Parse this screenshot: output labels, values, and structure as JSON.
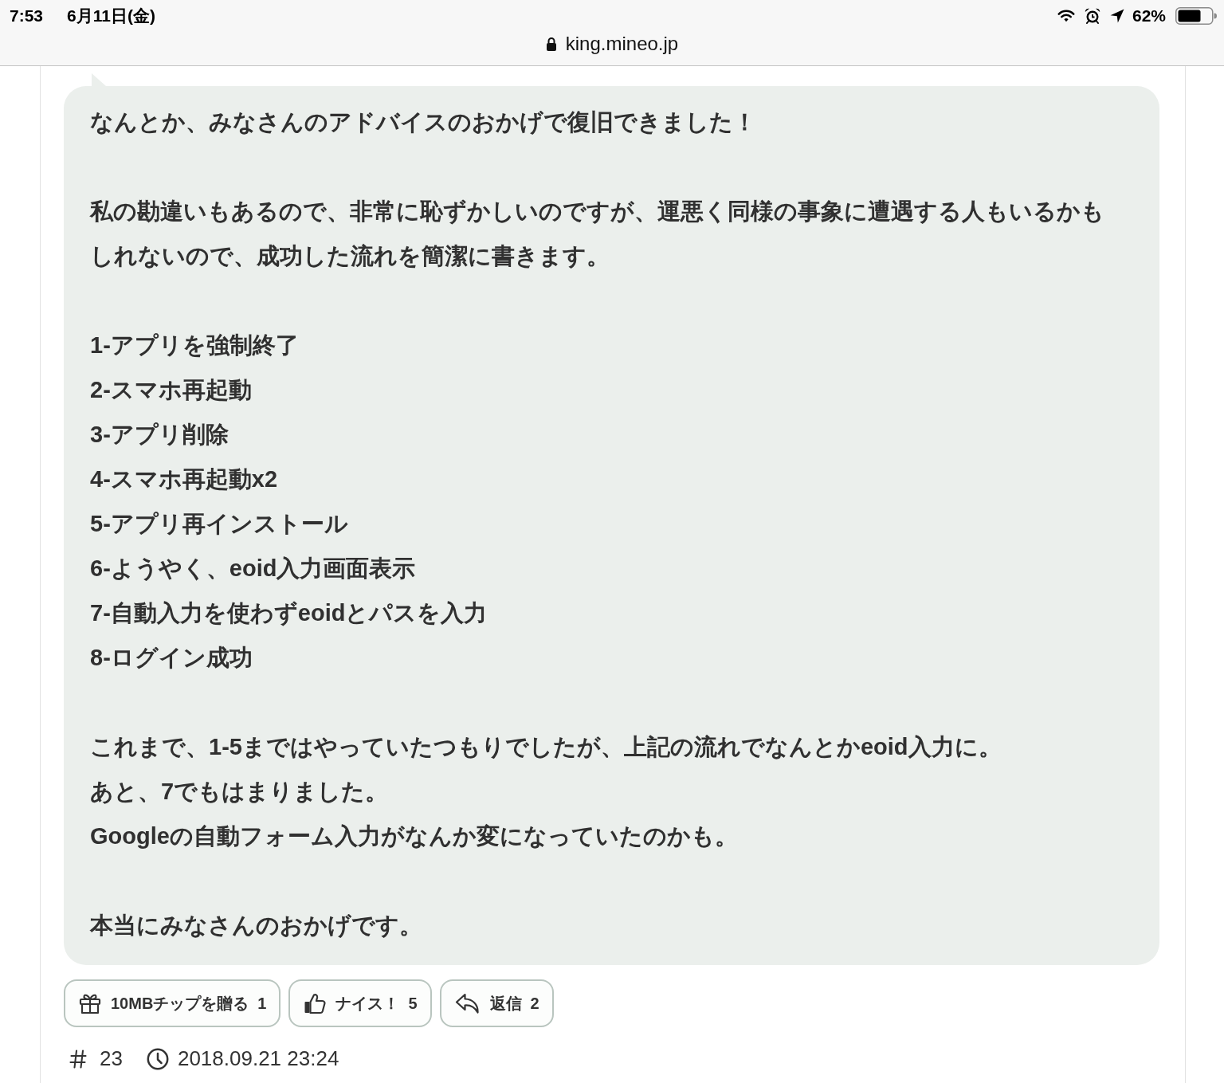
{
  "status_bar": {
    "time": "7:53",
    "date": "6月11日(金)",
    "battery": "62%"
  },
  "address_bar": {
    "url": "king.mineo.jp"
  },
  "post": {
    "paragraphs": [
      {
        "lines": [
          "なんとか、みなさんのアドバイスのおかげで復旧できました！"
        ]
      },
      {
        "lines": [
          "私の勘違いもあるので、非常に恥ずかしいのですが、運悪く同様の事象に遭遇する人もいるかもしれないので、成功した流れを簡潔に書きます。"
        ]
      },
      {
        "lines": [
          "1-アプリを強制終了",
          "2-スマホ再起動",
          "3-アプリ削除",
          "4-スマホ再起動x2",
          "5-アプリ再インストール",
          "6-ようやく、eoid入力画面表示",
          "7-自動入力を使わずeoidとパスを入力",
          "8-ログイン成功"
        ]
      },
      {
        "lines": [
          "これまで、1-5まではやっていたつもりでしたが、上記の流れでなんとかeoid入力に。",
          "あと、7でもはまりました。",
          "Googleの自動フォーム入力がなんか変になっていたのかも。"
        ]
      },
      {
        "lines": [
          "本当にみなさんのおかげです。"
        ]
      }
    ],
    "actions": [
      {
        "kind": "tip",
        "label": "10MBチップを贈る",
        "count": "1"
      },
      {
        "kind": "nice",
        "label": "ナイス！",
        "count": "5"
      },
      {
        "kind": "reply",
        "label": "返信",
        "count": "2"
      }
    ],
    "number": "23",
    "timestamp": "2018.09.21 23:24"
  }
}
